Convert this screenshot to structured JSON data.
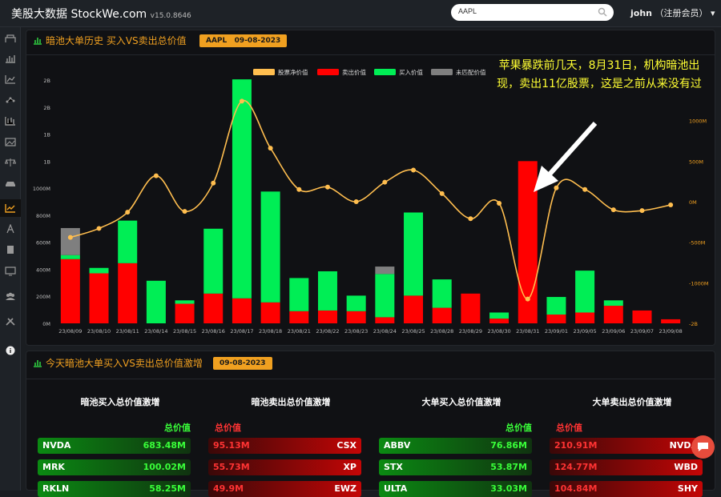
{
  "header": {
    "brand": "美股大数据 StockWe.com",
    "version": "v15.0.8646",
    "search_value": "AAPL",
    "user_name": "john",
    "user_role": "（注册会员）",
    "user_caret": "▾"
  },
  "sidebar": {
    "icons": [
      "dashboard-icon",
      "bar-chart-icon",
      "area-chart-icon",
      "scatter-icon",
      "candlestick-icon",
      "image-icon",
      "scale-icon",
      "car-icon",
      "line-chart-icon",
      "person-icon",
      "exam-icon",
      "monitor-icon",
      "group-icon",
      "tools-icon",
      "info-icon"
    ]
  },
  "panel1": {
    "title": "暗池大单历史 买入VS卖出总价值",
    "badge_ticker": "AAPL",
    "badge_date": "09-08-2023",
    "annotation": "苹果暴跌前几天，8月31日，机构暗池出现，卖出11亿股票，这是之前从来没有过"
  },
  "chart_data": {
    "type": "bar",
    "stacked": true,
    "categories": [
      "23/08/09",
      "23/08/10",
      "23/08/11",
      "23/08/14",
      "23/08/15",
      "23/08/16",
      "23/08/17",
      "23/08/18",
      "23/08/21",
      "23/08/22",
      "23/08/23",
      "23/08/24",
      "23/08/25",
      "23/08/28",
      "23/08/29",
      "23/08/30",
      "23/08/31",
      "23/09/01",
      "23/09/05",
      "23/09/06",
      "23/09/07",
      "23/09/08"
    ],
    "series": [
      {
        "name": "卖出价值",
        "type": "bar",
        "axis": "left",
        "color": "#ff0000",
        "values": [
          475,
          370,
          445,
          0,
          145,
          220,
          185,
          155,
          90,
          95,
          90,
          45,
          205,
          115,
          220,
          35,
          1200,
          65,
          80,
          130,
          95,
          30
        ]
      },
      {
        "name": "买入价值",
        "type": "bar",
        "axis": "left",
        "color": "#00ee55",
        "values": [
          30,
          40,
          315,
          315,
          25,
          480,
          1620,
          820,
          245,
          290,
          115,
          320,
          615,
          210,
          0,
          45,
          0,
          130,
          310,
          40,
          0,
          0
        ]
      },
      {
        "name": "未匹配价值",
        "type": "bar",
        "axis": "left",
        "color": "#7f7f7f",
        "values": [
          200,
          0,
          0,
          0,
          0,
          0,
          0,
          0,
          0,
          0,
          0,
          55,
          0,
          0,
          0,
          0,
          0,
          0,
          0,
          0,
          0,
          0
        ]
      },
      {
        "name": "股票净价值",
        "type": "line",
        "axis": "right",
        "color": "#ffbe4f",
        "values": [
          -440,
          -330,
          -130,
          320,
          -120,
          230,
          1240,
          660,
          150,
          180,
          0,
          240,
          390,
          100,
          -210,
          -20,
          -1200,
          170,
          150,
          -100,
          -110,
          -40
        ]
      }
    ],
    "left_axis_ticks": [
      "0M",
      "200M",
      "400M",
      "600M",
      "800M",
      "1000M",
      "1B",
      "1B",
      "2B",
      "2B"
    ],
    "left_axis_values": [
      0,
      200,
      400,
      600,
      800,
      1000,
      1200,
      1400,
      1600,
      1800
    ],
    "right_axis_ticks": [
      "-2B",
      "-1000M",
      "-500M",
      "0M",
      "500M",
      "1000M"
    ],
    "right_axis_values": [
      -1500,
      -1000,
      -500,
      0,
      500,
      1000
    ],
    "ylim_left": [
      0,
      1800
    ],
    "ylim_right": [
      -1500,
      1500
    ],
    "legend": [
      "股票净价值",
      "卖出价值",
      "买入价值",
      "未匹配价值"
    ],
    "legend_position": "top-right"
  },
  "panel2": {
    "title": "今天暗池大单买入VS卖出总价值激增",
    "badge_date": "09-08-2023",
    "columns": [
      {
        "title": "暗池买入总价值激增",
        "head": "总价值",
        "kind": "buy",
        "rows": [
          {
            "ticker": "NVDA",
            "value": "683.48M"
          },
          {
            "ticker": "MRK",
            "value": "100.02M"
          },
          {
            "ticker": "RKLN",
            "value": "58.25M"
          }
        ]
      },
      {
        "title": "暗池卖出总价值激增",
        "head": "总价值",
        "kind": "sell",
        "rows": [
          {
            "ticker": "CSX",
            "value": "95.13M"
          },
          {
            "ticker": "XP",
            "value": "55.73M"
          },
          {
            "ticker": "EWZ",
            "value": "49.9M"
          }
        ]
      },
      {
        "title": "大单买入总价值激增",
        "head": "总价值",
        "kind": "buy",
        "rows": [
          {
            "ticker": "ABBV",
            "value": "76.86M"
          },
          {
            "ticker": "STX",
            "value": "53.87M"
          },
          {
            "ticker": "ULTA",
            "value": "33.03M"
          }
        ]
      },
      {
        "title": "大单卖出总价值激增",
        "head": "总价值",
        "kind": "sell",
        "rows": [
          {
            "ticker": "NVDA",
            "value": "210.91M"
          },
          {
            "ticker": "WBD",
            "value": "124.77M"
          },
          {
            "ticker": "SHY",
            "value": "104.84M"
          }
        ]
      }
    ]
  }
}
